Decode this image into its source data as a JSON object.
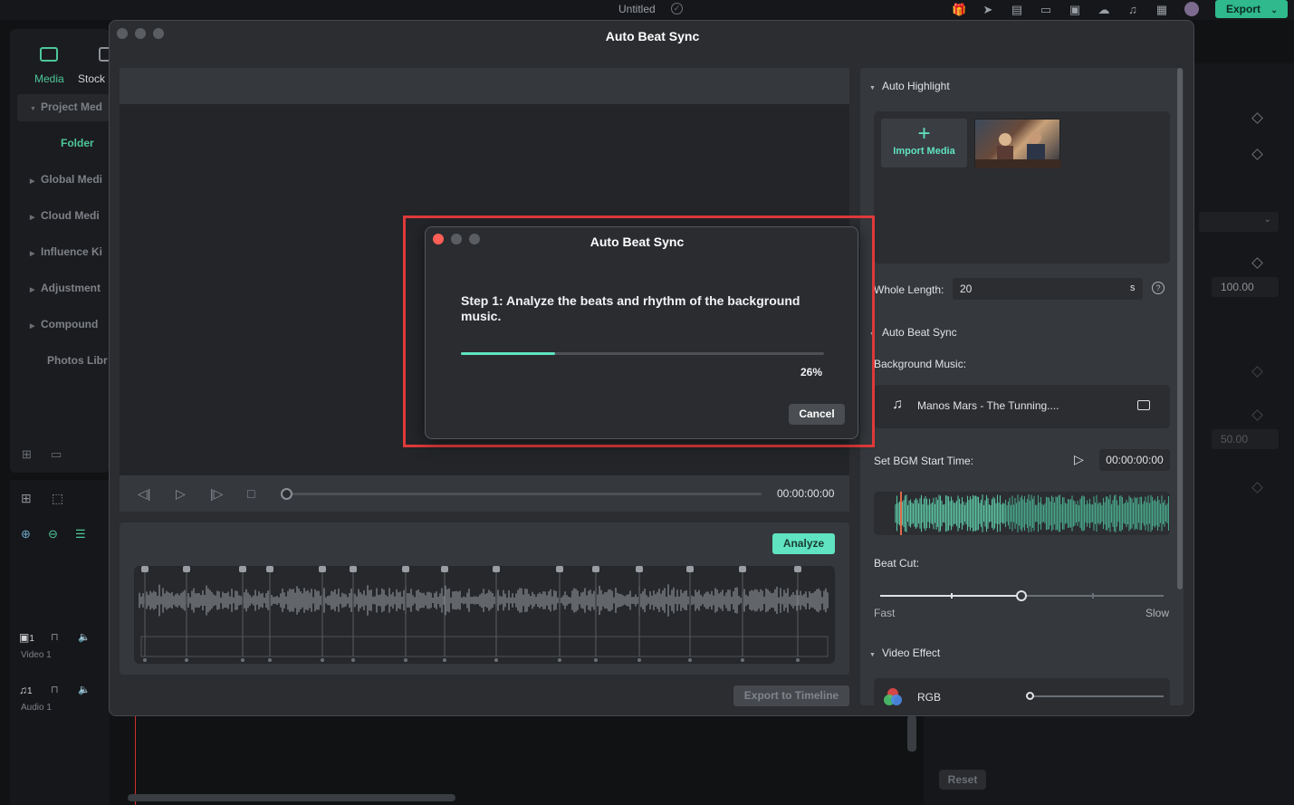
{
  "app": {
    "title": "Untitled",
    "export_label": "Export"
  },
  "left_panel": {
    "tabs": [
      "Media",
      "Stock"
    ],
    "items": [
      {
        "label": "Project Med",
        "expanded": true
      },
      {
        "label": "Folder"
      },
      {
        "label": "Global Medi"
      },
      {
        "label": "Cloud Medi"
      },
      {
        "label": "Influence Ki"
      },
      {
        "label": "Adjustment"
      },
      {
        "label": "Compound"
      },
      {
        "label": "Photos Libr"
      }
    ]
  },
  "tracks": {
    "video": "Video 1",
    "audio": "Audio 1",
    "video_num": "1",
    "audio_num": "1"
  },
  "background_right": {
    "value1": "100.00",
    "value2": "50.00",
    "reset_label": "Reset"
  },
  "dialog": {
    "title": "Auto Beat Sync",
    "player_time": "00:00:00:00",
    "analyze_label": "Analyze",
    "export_timeline_label": "Export to Timeline"
  },
  "settings": {
    "auto_highlight_title": "Auto Highlight",
    "import_media_label": "Import Media",
    "whole_length_label": "Whole Length:",
    "whole_length_value": "20",
    "whole_length_unit": "s",
    "auto_beat_sync_title": "Auto Beat Sync",
    "background_music_label": "Background Music:",
    "music_name": "Manos Mars - The Tunning....",
    "bgm_start_label": "Set BGM Start Time:",
    "bgm_start_time": "00:00:00:00",
    "beat_cut_label": "Beat Cut:",
    "beat_cut_min": "Fast",
    "beat_cut_max": "Slow",
    "beat_cut_level": 0.5,
    "video_effect_title": "Video Effect",
    "effect_name": "RGB"
  },
  "modal": {
    "title": "Auto Beat Sync",
    "step_text": "Step 1: Analyze the beats and rhythm of the background music.",
    "progress": 26,
    "progress_label": "26%",
    "cancel_label": "Cancel"
  },
  "colors": {
    "accent": "#5fe3c0",
    "highlight_border": "#e03a3a",
    "close_dot": "#ff5f57",
    "brand_export": "#2fb98d"
  }
}
